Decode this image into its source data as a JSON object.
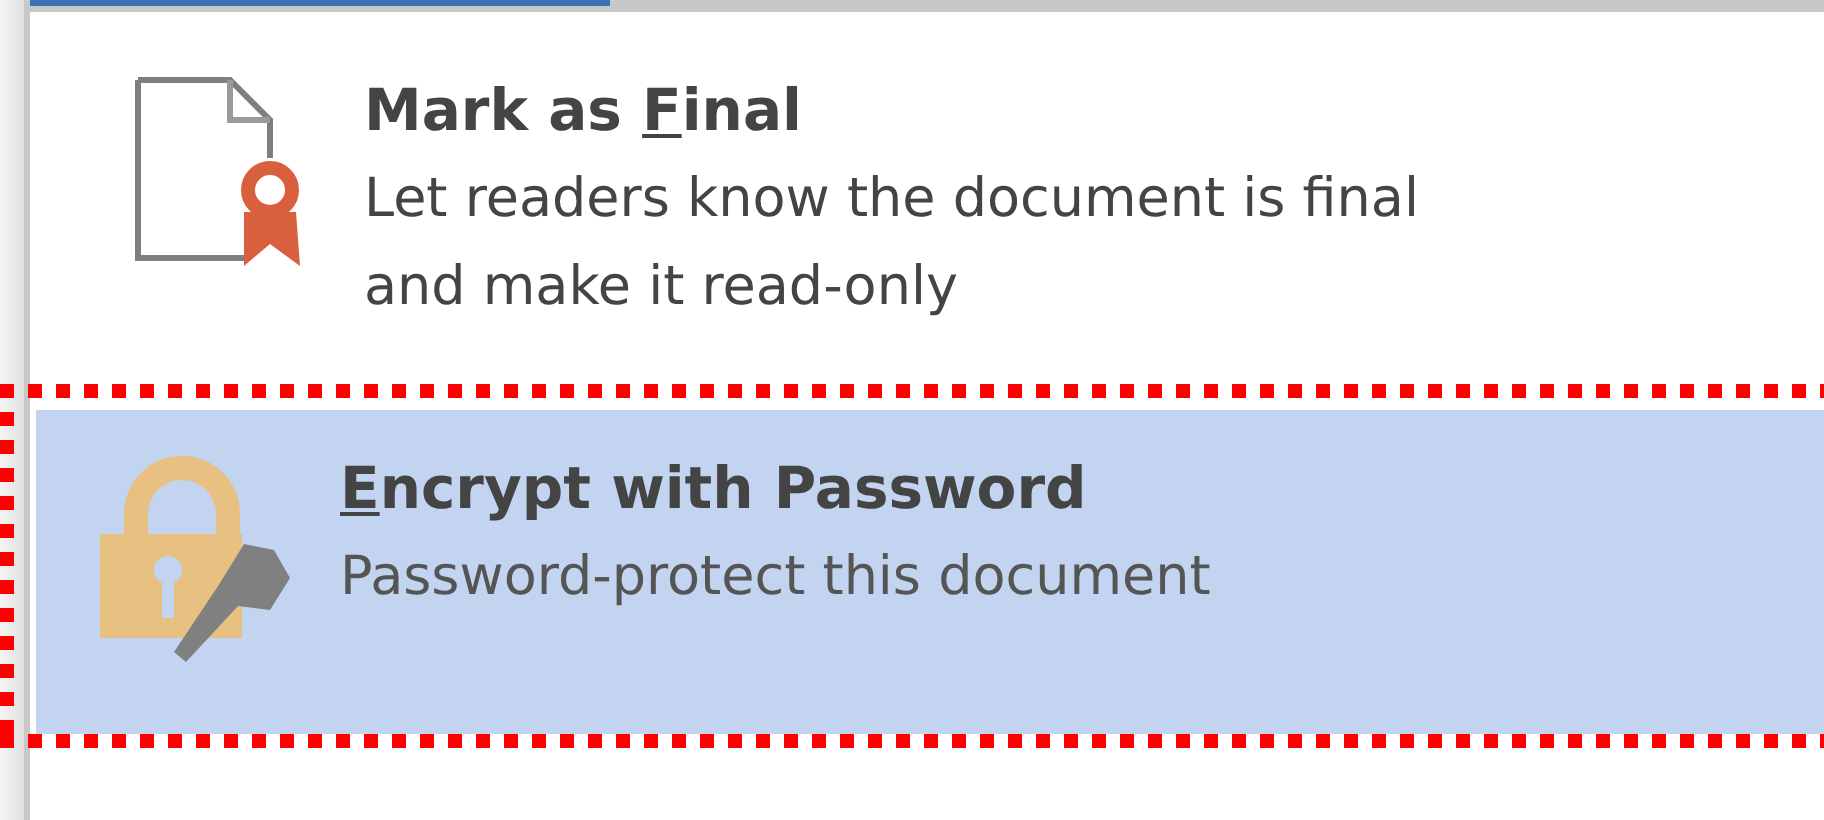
{
  "menu_items": [
    {
      "kind": "mark-final",
      "title_before": "Mark as ",
      "access_key": "F",
      "title_after": "inal",
      "description": "Let readers know the document is final and make it read-only",
      "selected": false,
      "marked": false
    },
    {
      "kind": "encrypt",
      "access_key": "E",
      "title_after": "ncrypt with Password",
      "description": "Password-protect this document",
      "selected": true,
      "marked": true
    }
  ]
}
